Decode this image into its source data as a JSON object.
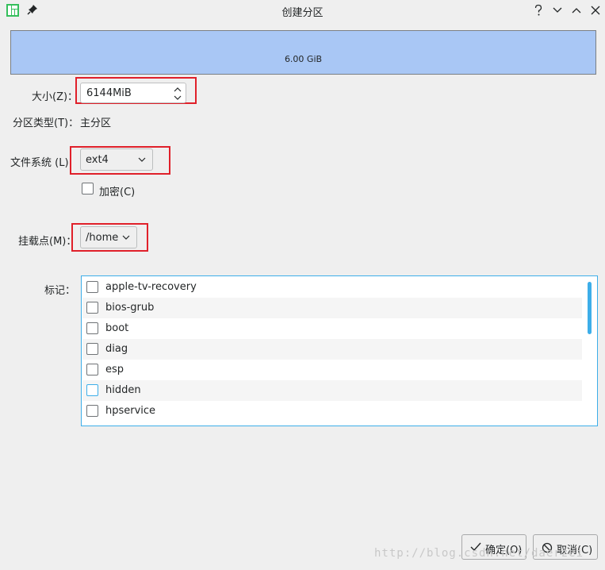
{
  "window": {
    "title": "创建分区"
  },
  "partition_bar": {
    "size_label": "6.00 GiB"
  },
  "form": {
    "size_label": "大小(Z)：",
    "size_value": "6144MiB",
    "partition_type_label": "分区类型(T)：",
    "partition_type_value": "主分区",
    "filesystem_label": "文件系统 (L)",
    "filesystem_value": "ext4",
    "encrypt_label": "加密(C)",
    "mountpoint_label": "挂载点(M)：",
    "mountpoint_value": "/home",
    "flags_label": "标记："
  },
  "flags": [
    {
      "name": "apple-tv-recovery",
      "checked": false
    },
    {
      "name": "bios-grub",
      "checked": false
    },
    {
      "name": "boot",
      "checked": false
    },
    {
      "name": "diag",
      "checked": false
    },
    {
      "name": "esp",
      "checked": false
    },
    {
      "name": "hidden",
      "checked": false
    },
    {
      "name": "hpservice",
      "checked": false
    }
  ],
  "buttons": {
    "ok": "确定(O)",
    "cancel": "取消(C)"
  },
  "watermark": "http://blog.csdn.net/daerzei",
  "colors": {
    "accent": "#3daee9",
    "highlight_box": "#e0202a",
    "partition_fill": "#a9c7f5"
  }
}
